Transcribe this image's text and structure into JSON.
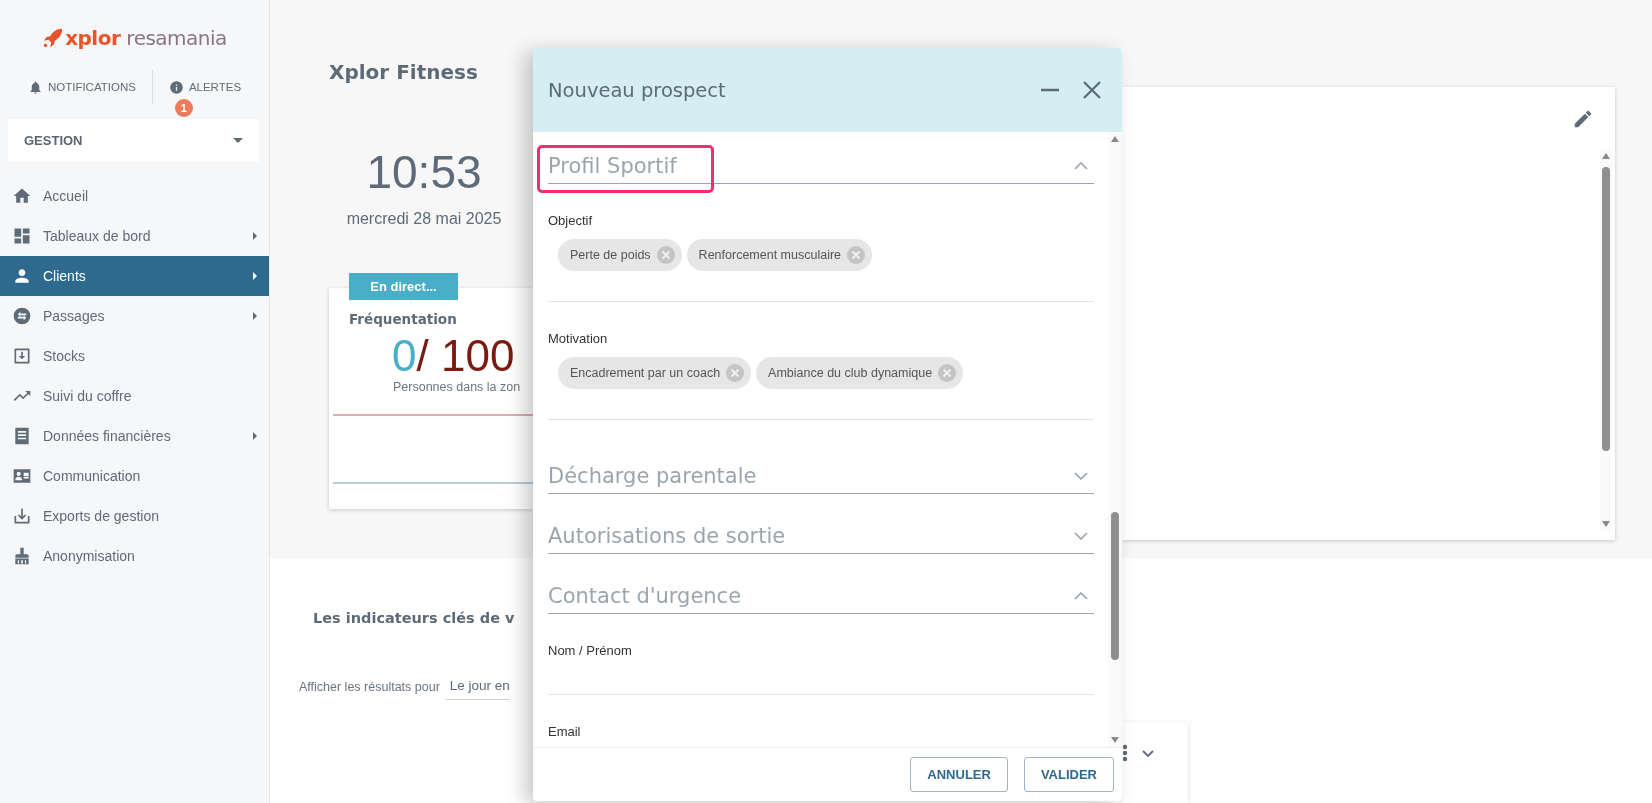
{
  "sidebar": {
    "logo": {
      "brand": "xplor",
      "product": "resamania"
    },
    "notifications": {
      "label": "NOTIFICATIONS"
    },
    "alerts": {
      "label": "ALERTES",
      "badge": "1"
    },
    "module_select": {
      "value": "GESTION"
    },
    "items": [
      {
        "label": "Accueil",
        "submenu": false,
        "selected": false
      },
      {
        "label": "Tableaux de bord",
        "submenu": true,
        "selected": false
      },
      {
        "label": "Clients",
        "submenu": true,
        "selected": true
      },
      {
        "label": "Passages",
        "submenu": true,
        "selected": false
      },
      {
        "label": "Stocks",
        "submenu": false,
        "selected": false
      },
      {
        "label": "Suivi du coffre",
        "submenu": false,
        "selected": false
      },
      {
        "label": "Données financières",
        "submenu": true,
        "selected": false
      },
      {
        "label": "Communication",
        "submenu": false,
        "selected": false
      },
      {
        "label": "Exports de gestion",
        "submenu": false,
        "selected": false
      },
      {
        "label": "Anonymisation",
        "submenu": false,
        "selected": false
      }
    ]
  },
  "dashboard": {
    "site_title": "Xplor Fitness",
    "clock": {
      "time": "10:53",
      "date": "mercredi 28 mai 2025"
    },
    "attendance_card": {
      "badge": "En direct...",
      "title": "Fréquentation",
      "current": "0",
      "capacity": "/ 100",
      "caption": "Personnes dans la zon"
    },
    "kpi_heading": "Les indicateurs clés de v",
    "period": {
      "label": "Afficher les résultats pour",
      "value": "Le jour en"
    }
  },
  "dialog": {
    "title": "Nouveau prospect",
    "sections": [
      {
        "title": "Profil Sportif",
        "expanded": true,
        "highlighted": true,
        "fields": [
          {
            "label": "Objectif",
            "kind": "chips",
            "chips": [
              "Perte de poids",
              "Renforcement musculaire"
            ]
          },
          {
            "label": "Motivation",
            "kind": "chips",
            "chips": [
              "Encadrement par un coach",
              "Ambiance du club dynamique"
            ]
          }
        ]
      },
      {
        "title": "Décharge parentale",
        "expanded": false,
        "highlighted": false
      },
      {
        "title": "Autorisations de sortie",
        "expanded": false,
        "highlighted": false
      },
      {
        "title": "Contact d'urgence",
        "expanded": true,
        "highlighted": false,
        "fields": [
          {
            "label": "Nom / Prénom",
            "kind": "text"
          },
          {
            "label": "Email"
          }
        ]
      }
    ],
    "buttons": [
      {
        "label": "ANNULER"
      },
      {
        "label": "VALIDER"
      }
    ]
  }
}
